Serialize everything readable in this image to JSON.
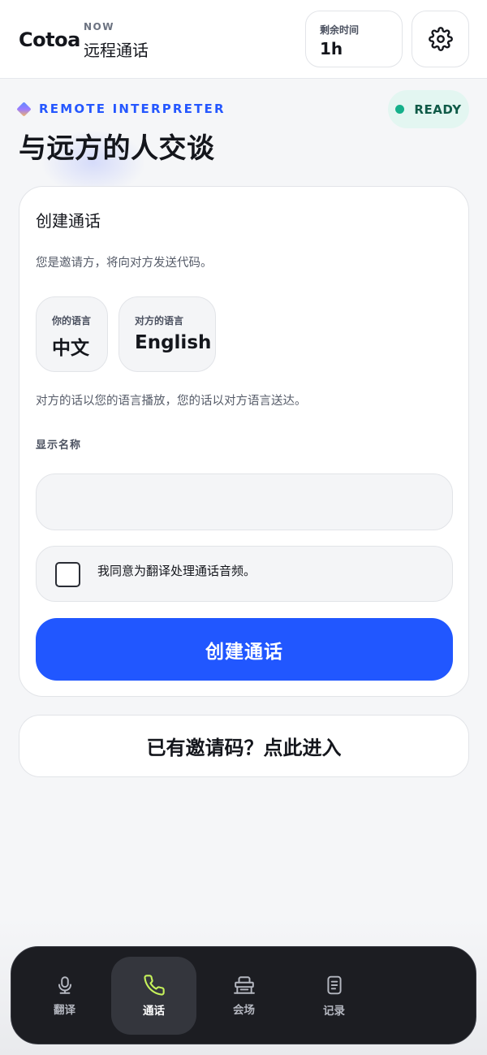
{
  "header": {
    "brand": "Cotoa",
    "now_label": "NOW",
    "now_title": "远程通话",
    "time_label": "剩余时间",
    "time_value": "1h",
    "settings_icon": "gear-icon"
  },
  "hero": {
    "kicker": "REMOTE INTERPRETER",
    "status": "READY",
    "status_color": "#14b08a",
    "title": "与远方的人交谈"
  },
  "create_card": {
    "title": "创建通话",
    "subtitle": "您是邀请方，将向对方发送代码。",
    "my_language_label": "你的语言",
    "my_language_value": "中文",
    "their_language_label": "对方的语言",
    "their_language_value": "English",
    "hint": "对方的话以您的语言播放，您的话以对方语言送达。",
    "display_name_label": "显示名称",
    "display_name_value": "",
    "display_name_placeholder": "",
    "consent_text": "我同意为翻译处理通话音频。",
    "consent_checked": false,
    "create_button": "创建通话"
  },
  "invite": {
    "button": "已有邀请码？点此进入"
  },
  "nav": {
    "items": [
      {
        "label": "翻译",
        "icon": "microphone-icon",
        "active": false
      },
      {
        "label": "通话",
        "icon": "phone-icon",
        "active": true
      },
      {
        "label": "会场",
        "icon": "venue-icon",
        "active": false
      },
      {
        "label": "记录",
        "icon": "document-icon",
        "active": false
      }
    ]
  },
  "colors": {
    "accent": "#2157ff",
    "active_icon": "#c6f25b"
  }
}
